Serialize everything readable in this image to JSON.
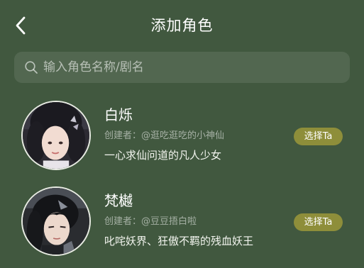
{
  "header": {
    "title": "添加角色"
  },
  "search": {
    "placeholder": "输入角色名称/剧名"
  },
  "roles": [
    {
      "name": "白烁",
      "creator": "创建者：@逛吃逛吃的小神仙",
      "description": "一心求仙问道的凡人少女",
      "action_label": "选择Ta"
    },
    {
      "name": "梵樾",
      "creator": "创建者：@豆豆捂白啦",
      "description": "叱咤妖界、狂傲不羁的残血妖王",
      "action_label": "选择Ta"
    }
  ],
  "colors": {
    "background": "#41583f",
    "search_bg": "rgba(255,255,255,0.09)",
    "select_button": "#8e8e3a",
    "avatar_border": "#e9ece4"
  },
  "icons": {
    "back": "chevron-left-icon",
    "search": "search-icon"
  }
}
